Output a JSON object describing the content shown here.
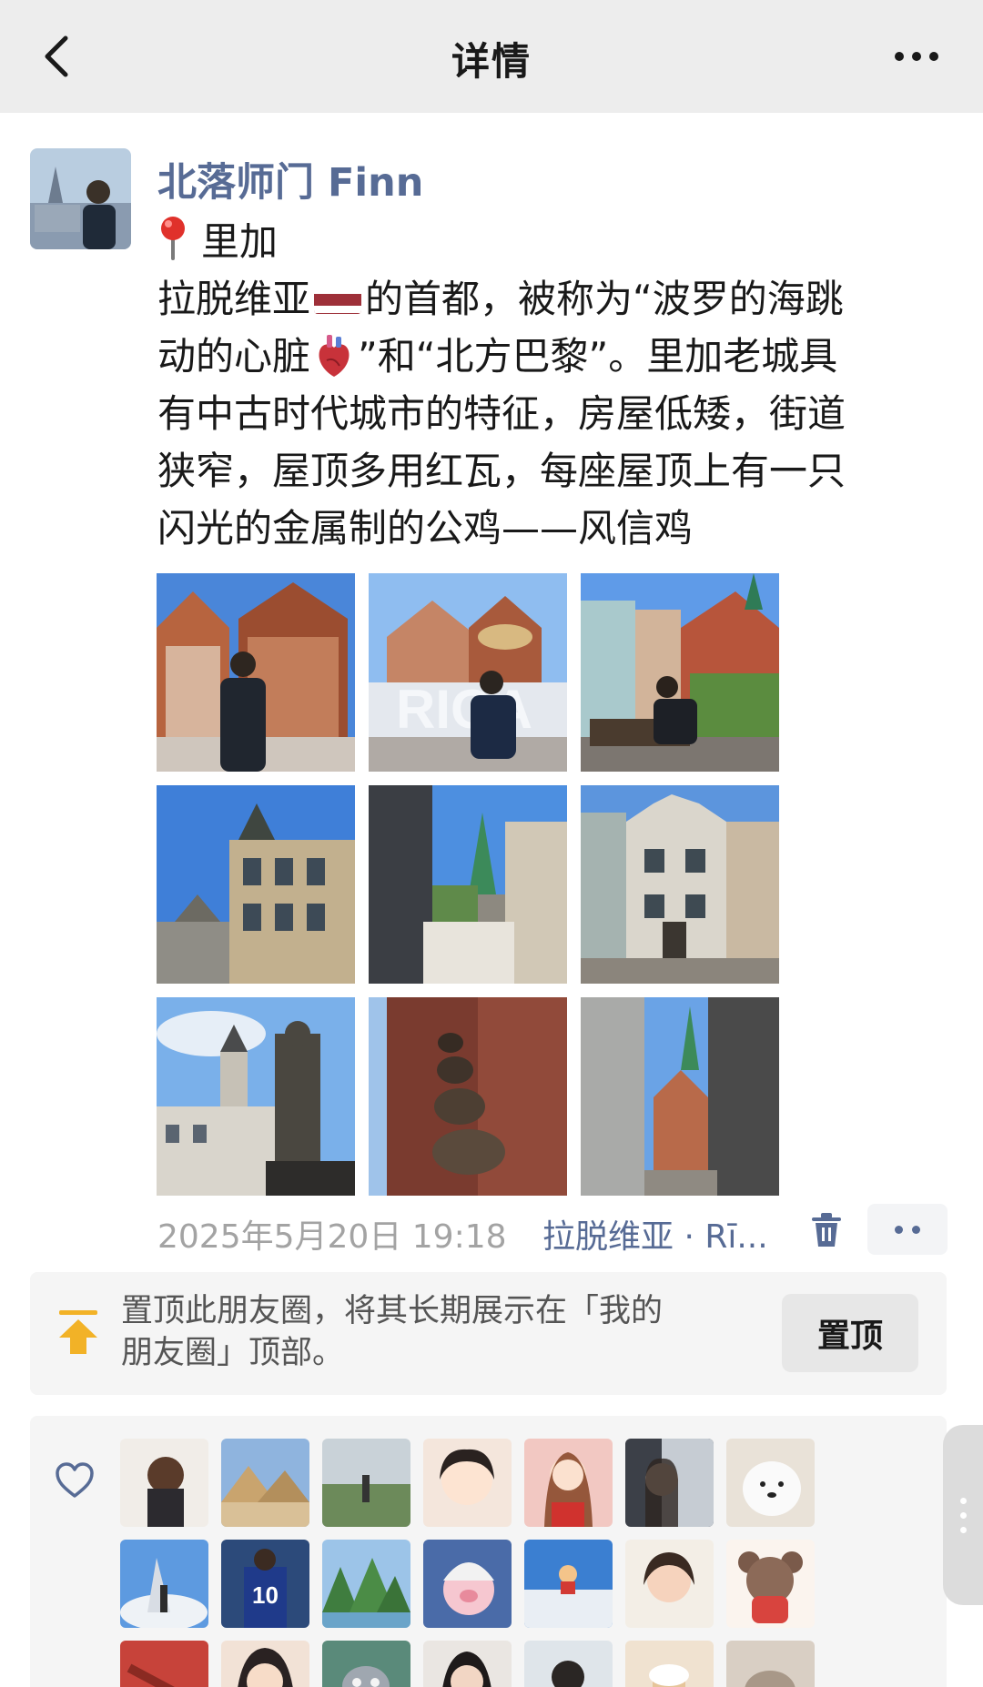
{
  "navbar": {
    "title": "详情"
  },
  "post": {
    "author": "北落师门 Finn",
    "location_line": "里加",
    "text_line1_a": "拉脱维亚",
    "text_line1_b": "的首都，被称为“波罗的海跳",
    "text_line2_a": "动的心脏",
    "text_line2_b": "”和“北方巴黎”。里加老城具",
    "text_rest": "有中古时代城市的特征，房屋低矮，街道\n狭窄，屋顶多用红瓦，每座屋顶上有一只\n闪光的金属制的公鸡——风信鸡",
    "photos_count": 9,
    "timestamp": "2025年5月20日 19:18",
    "place": "拉脱维亚 · Rī..."
  },
  "pin_prompt": {
    "text": "置顶此朋友圈，将其长期展示在「我的朋友圈」顶部。",
    "button_label": "置顶"
  },
  "likes": {
    "avatar_count": 21
  },
  "colors": {
    "nav_bg": "#ededed",
    "link_blue": "#576b95",
    "meta_gray": "#a3a3a3",
    "panel_bg": "#f5f5f5"
  },
  "icons": [
    "back-icon",
    "more-icon",
    "pin-location-icon",
    "latvia-flag-icon",
    "anatomical-heart-icon",
    "trash-icon",
    "pin-to-top-icon",
    "heart-outline-icon"
  ]
}
